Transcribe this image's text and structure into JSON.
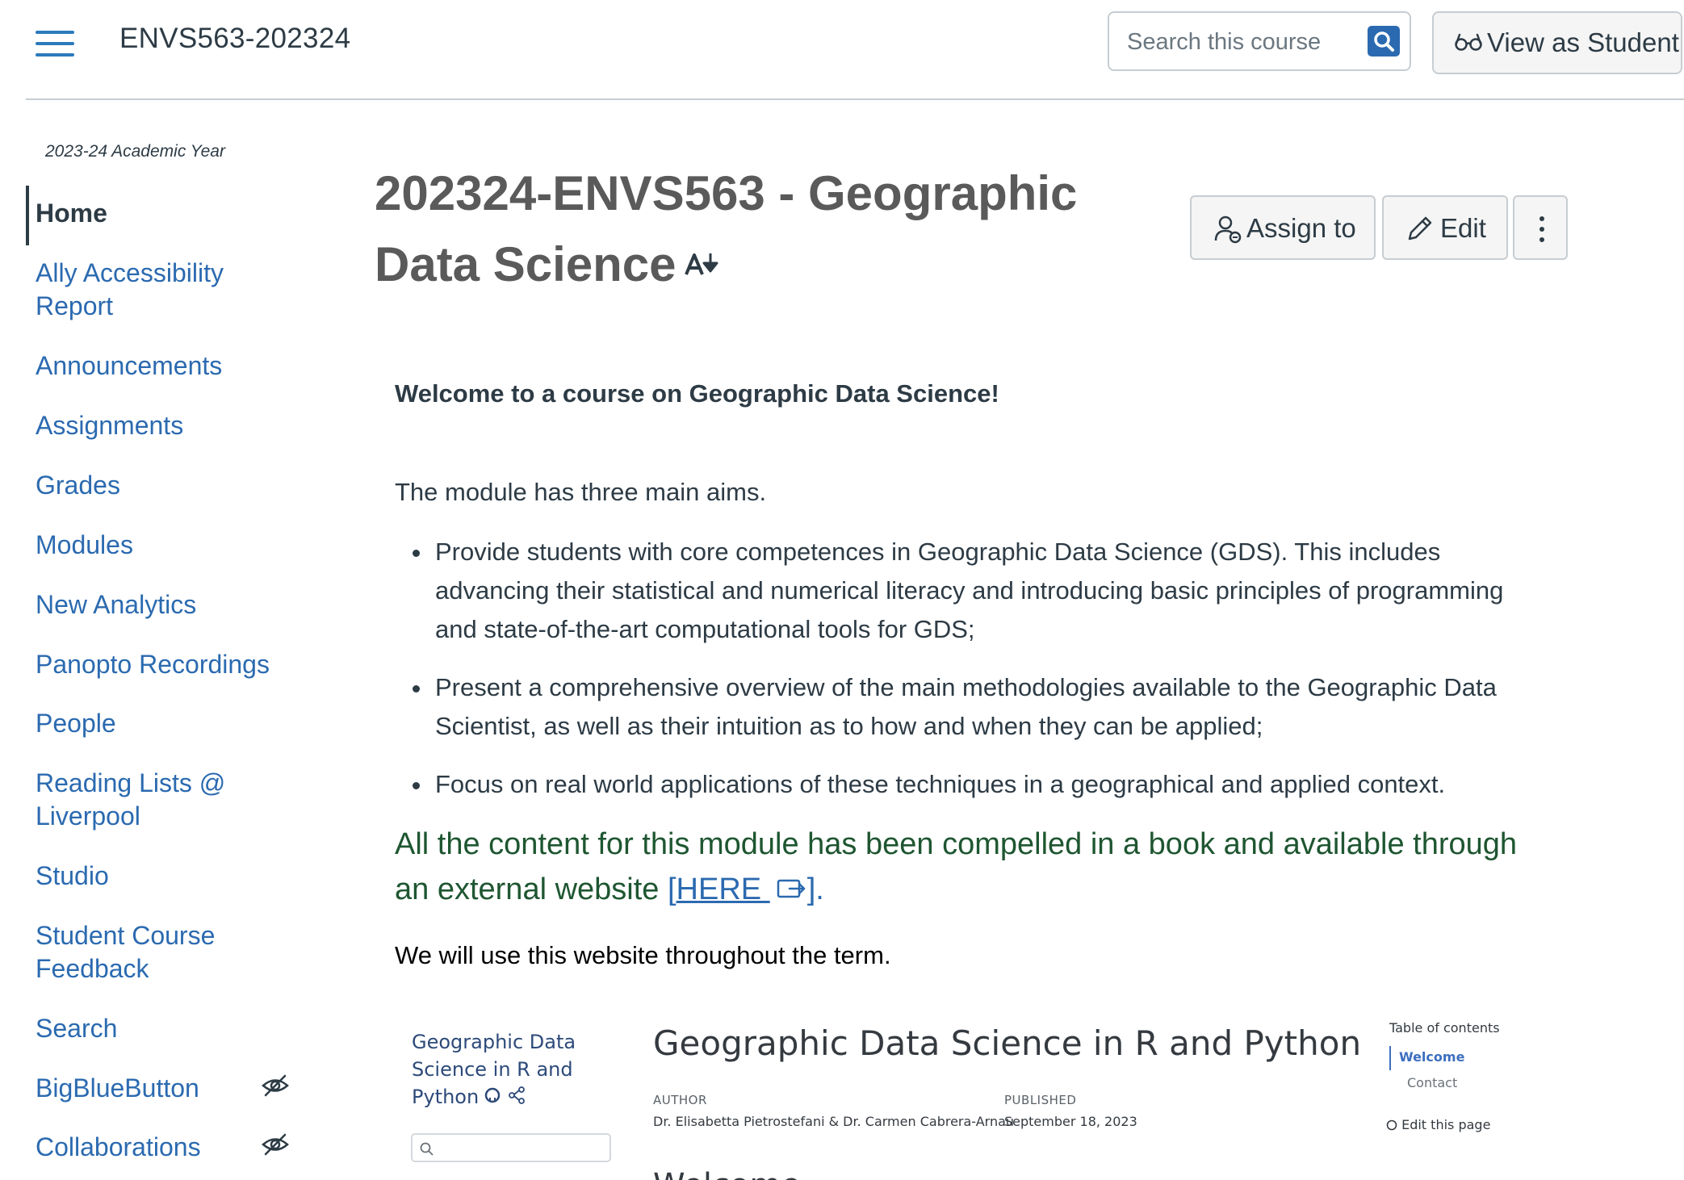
{
  "header": {
    "course_code": "ENVS563-202324",
    "search_placeholder": "Search this course",
    "view_as_student": "View as Student"
  },
  "sidebar": {
    "academic_year": "2023-24 Academic Year",
    "items": [
      {
        "label": "Home",
        "active": true
      },
      {
        "label": "Ally Accessibility Report"
      },
      {
        "label": "Announcements"
      },
      {
        "label": "Assignments"
      },
      {
        "label": "Grades"
      },
      {
        "label": "Modules"
      },
      {
        "label": "New Analytics"
      },
      {
        "label": "Panopto Recordings"
      },
      {
        "label": "People"
      },
      {
        "label": "Reading Lists @ Liverpool"
      },
      {
        "label": "Studio"
      },
      {
        "label": "Student Course Feedback"
      },
      {
        "label": "Search"
      },
      {
        "label": "BigBlueButton",
        "hidden_icon": "eye-slash-icon"
      },
      {
        "label": "Collaborations",
        "hidden_icon": "eye-slash-icon"
      }
    ]
  },
  "page": {
    "title": "202324-ENVS563 - Geographic Data Science",
    "buttons": {
      "assign": "Assign to",
      "edit": "Edit"
    },
    "welcome": "Welcome to a course on Geographic Data Science!",
    "aims_intro": "The module has three main aims.",
    "aims": [
      "Provide students with core competences in Geographic Data Science (GDS). This includes advancing their statistical and numerical literacy and introducing basic principles of programming and state-of-the-art computational tools for GDS;",
      "Present a comprehensive overview of the main methodologies available to the Geographic Data Scientist, as well as their intuition as to how and when they can be applied;",
      "Focus on real world applications of these techniques in a geographical and applied context."
    ],
    "book_note_prefix": "All the content for this module has been compelled in a book and available through an external website ",
    "book_note_open": "[",
    "book_link": "HERE ",
    "book_note_close": "].",
    "use_note": "We will use this website throughout the term."
  },
  "embed": {
    "side_title": "Geographic Data Science in R and Python",
    "main_title": "Geographic Data Science in R and Python",
    "author_label": "AUTHOR",
    "author_value": "Dr. Elisabetta Pietrostefani & Dr. Carmen Cabrera-Arnau",
    "published_label": "PUBLISHED",
    "published_value": "September 18, 2023",
    "toc_title": "Table of contents",
    "toc_active": "Welcome",
    "toc_item": "Contact",
    "edit_page": "Edit this page",
    "cut_heading": "Welcome"
  },
  "colors": {
    "link": "#2b6ab0",
    "text": "#2d3b45",
    "title": "#5a5a5a",
    "green_note": "#1e5631"
  }
}
